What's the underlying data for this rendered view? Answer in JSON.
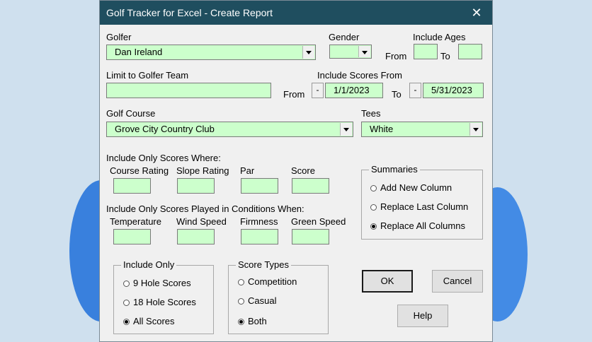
{
  "window": {
    "title": "Golf Tracker for Excel - Create Report",
    "close_glyph": "✕"
  },
  "golfer": {
    "label": "Golfer",
    "value": "Dan Ireland"
  },
  "gender": {
    "label": "Gender",
    "value": ""
  },
  "ages": {
    "label": "Include Ages",
    "from_label": "From",
    "to_label": "To",
    "from_value": "",
    "to_value": ""
  },
  "team": {
    "label": "Limit to Golfer Team",
    "value": ""
  },
  "scores_from": {
    "label": "Include Scores From",
    "from_label": "From",
    "to_label": "To",
    "minus_label": "-",
    "from_value": "1/1/2023",
    "to_value": "5/31/2023"
  },
  "course": {
    "label": "Golf Course",
    "value": "Grove City Country Club"
  },
  "tees": {
    "label": "Tees",
    "value": "White"
  },
  "score_filters": {
    "heading": "Include Only Scores Where:",
    "fields": [
      {
        "label": "Course Rating",
        "value": ""
      },
      {
        "label": "Slope Rating",
        "value": ""
      },
      {
        "label": "Par",
        "value": ""
      },
      {
        "label": "Score",
        "value": ""
      }
    ]
  },
  "conditions": {
    "heading": "Include Only Scores Played in Conditions When:",
    "fields": [
      {
        "label": "Temperature",
        "value": ""
      },
      {
        "label": "Wind Speed",
        "value": ""
      },
      {
        "label": "Firmness",
        "value": ""
      },
      {
        "label": "Green Speed",
        "value": ""
      }
    ]
  },
  "summaries": {
    "title": "Summaries",
    "options": [
      {
        "label": "Add New Column",
        "selected": false
      },
      {
        "label": "Replace Last Column",
        "selected": false
      },
      {
        "label": "Replace All Columns",
        "selected": true
      }
    ]
  },
  "include_only": {
    "title": "Include Only",
    "options": [
      {
        "label": "9 Hole Scores",
        "selected": false
      },
      {
        "label": "18 Hole Scores",
        "selected": false
      },
      {
        "label": "All Scores",
        "selected": true
      }
    ]
  },
  "score_types": {
    "title": "Score Types",
    "options": [
      {
        "label": "Competition",
        "selected": false
      },
      {
        "label": "Casual",
        "selected": false
      },
      {
        "label": "Both",
        "selected": true
      }
    ]
  },
  "buttons": {
    "ok": "OK",
    "cancel": "Cancel",
    "help": "Help"
  },
  "colors": {
    "field_bg": "#ccffcc",
    "titlebar": "#1f4e5f",
    "dialog_bg": "#f0f0f0",
    "wallpaper": "#cfe0ee",
    "swirl": "#1e6fd9"
  }
}
